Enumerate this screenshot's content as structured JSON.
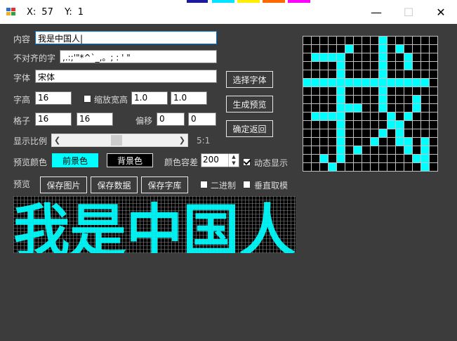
{
  "title_bar": {
    "x_label": "X:",
    "x_value": "57",
    "y_label": "Y:",
    "y_value": "1",
    "minimize": "—",
    "maximize": "☐",
    "close": "✕"
  },
  "form": {
    "content_label": "内容",
    "content_value": "我是中国人|",
    "misalign_label": "不对齐的字",
    "misalign_value": ",.:;'\"*^`_,。; : ' \"",
    "font_label": "字体",
    "font_value": "宋体",
    "choose_font_button": "选择字体",
    "char_height_label": "字高",
    "char_height_value": "16",
    "scale_wh_label": "缩放宽高",
    "scale_w_value": "1.0",
    "scale_h_value": "1.0",
    "generate_preview_button": "生成预览",
    "grid_label": "格子",
    "grid_w_value": "16",
    "grid_h_value": "16",
    "offset_label": "偏移",
    "offset_x_value": "0",
    "offset_y_value": "0",
    "confirm_return_button": "确定返回",
    "display_scale_label": "显示比例",
    "scale_ratio": "5:1",
    "slider_position": 0.47,
    "preview_color_label": "预览颜色",
    "foreground_button": "前景色",
    "background_button": "背景色",
    "color_tolerance_label": "颜色容差",
    "color_tolerance_value": "200",
    "dynamic_display_label": "动态显示",
    "dynamic_display_checked": true,
    "preview_label": "预览",
    "save_image_button": "保存图片",
    "save_data_button": "保存数据",
    "save_font_lib_button": "保存字库",
    "binary_label": "二进制",
    "binary_checked": false,
    "vertical_sample_label": "垂直取模",
    "vertical_checked": false,
    "scale_checked": false
  },
  "colors": {
    "foreground": "#00ffff",
    "background": "#000000",
    "grid": "#c0c0c0",
    "panel": "#3c3c3c"
  },
  "glyph_bitmap": [
    "0000000001000000",
    "0000010001010000",
    "0111100001001000",
    "0000100001001000",
    "0000100001000000",
    "1111111111111110",
    "0000100001000000",
    "0000100001000100",
    "0000111001000100",
    "0111100000101000",
    "0000100000110000",
    "0000100001010000",
    "0000100010011010",
    "0000101000001010",
    "0010100000000110",
    "0001000000000010"
  ],
  "preview_text": "我是中国人"
}
